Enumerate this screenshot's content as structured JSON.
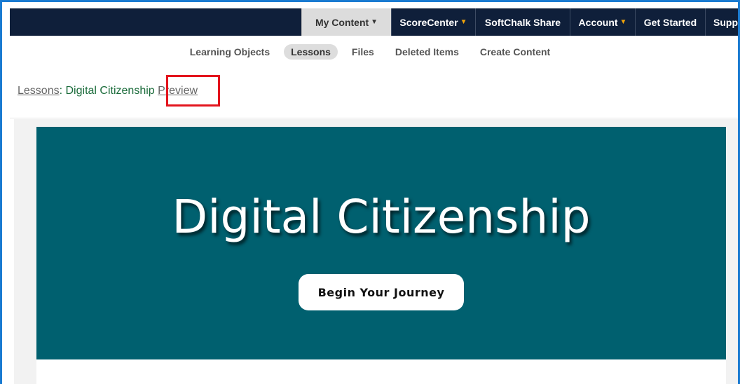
{
  "top_nav": {
    "items": [
      {
        "label": "My Content",
        "caret": "▼"
      },
      {
        "label": "ScoreCenter",
        "caret": "▼"
      },
      {
        "label": "SoftChalk Share",
        "caret": ""
      },
      {
        "label": "Account",
        "caret": "▼"
      },
      {
        "label": "Get Started",
        "caret": ""
      },
      {
        "label": "Suppor",
        "caret": ""
      }
    ],
    "active_index": 0,
    "colors": {
      "bar": "#0f1f3a",
      "caret_accent": "#f0a30a",
      "active_bg": "#dcdcdc"
    }
  },
  "sub_nav": {
    "items": [
      "Learning Objects",
      "Lessons",
      "Files",
      "Deleted Items",
      "Create Content"
    ],
    "active_index": 1
  },
  "breadcrumb": {
    "parent": "Lessons",
    "separator": ":",
    "current": "Digital Citizenship",
    "action": "Preview"
  },
  "hero": {
    "title": "Digital Citizenship",
    "button_label": "Begin Your Journey",
    "background": "#00606f"
  },
  "annotation": {
    "highlight_color": "#e3141d",
    "frame_color": "#1a7bd1"
  }
}
